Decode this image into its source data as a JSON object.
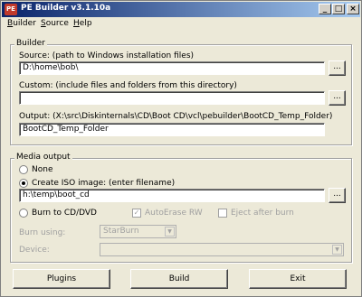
{
  "window": {
    "title": "PE Builder v3.1.10a",
    "icon_text": "PE",
    "controls": {
      "minimize": "_",
      "maximize": "□",
      "close": "×"
    }
  },
  "menu": [
    {
      "label": "Builder",
      "accel": "B",
      "rest": "uilder"
    },
    {
      "label": "Source",
      "accel": "S",
      "rest": "ource"
    },
    {
      "label": "Help",
      "accel": "H",
      "rest": "elp"
    }
  ],
  "builder": {
    "group_label": "Builder",
    "source_label": "Source: (path to Windows installation files)",
    "source_value": "D:\\home\\bob\\",
    "custom_label": "Custom: (include files and folders from this directory)",
    "custom_value": "",
    "output_label": "Output: (X:\\src\\Diskinternals\\CD\\Boot CD\\vcl\\pebuilder\\BootCD_Temp_Folder)",
    "output_value": "BootCD_Temp_Folder",
    "browse_label": "..."
  },
  "media": {
    "group_label": "Media output",
    "none_label": "None",
    "iso_label": "Create ISO image: (enter filename)",
    "iso_value": "h:\\temp\\boot_cd",
    "burn_label": "Burn to CD/DVD",
    "autoerase_label": "AutoErase RW",
    "eject_label": "Eject after burn",
    "burn_using_label": "Burn using:",
    "burn_using_value": "StarBurn",
    "device_label": "Device:",
    "device_value": "",
    "selected": "iso",
    "autoerase_checked": true,
    "eject_checked": false
  },
  "buttons": {
    "plugins": "Plugins",
    "build": "Build",
    "exit": "Exit"
  }
}
